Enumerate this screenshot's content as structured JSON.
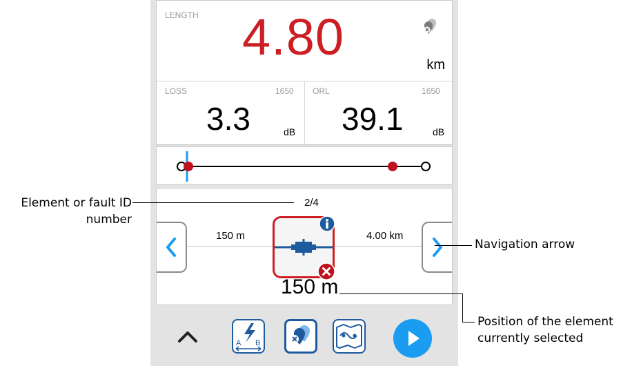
{
  "length": {
    "label": "LENGTH",
    "value": "4.80",
    "unit": "km",
    "color": "#cc1e23"
  },
  "loss": {
    "label": "LOSS",
    "wavelength": "1650",
    "value": "3.3",
    "unit": "dB"
  },
  "orl": {
    "label": "ORL",
    "wavelength": "1650",
    "value": "39.1",
    "unit": "dB"
  },
  "element": {
    "id": "2/4",
    "left_distance": "150 m",
    "right_distance": "4.00 km",
    "position": "150 m"
  },
  "toolbar": {
    "buttons": [
      "chevron-up-icon",
      "ab-span-icon",
      "element-selector-icon",
      "map-icon",
      "play-icon"
    ],
    "accent": "#1e5a9e",
    "play_color": "#1a9cf0"
  },
  "callouts": {
    "element_id": "Element or fault ID number",
    "navigation": "Navigation arrow",
    "position": "Position of the element currently selected"
  }
}
